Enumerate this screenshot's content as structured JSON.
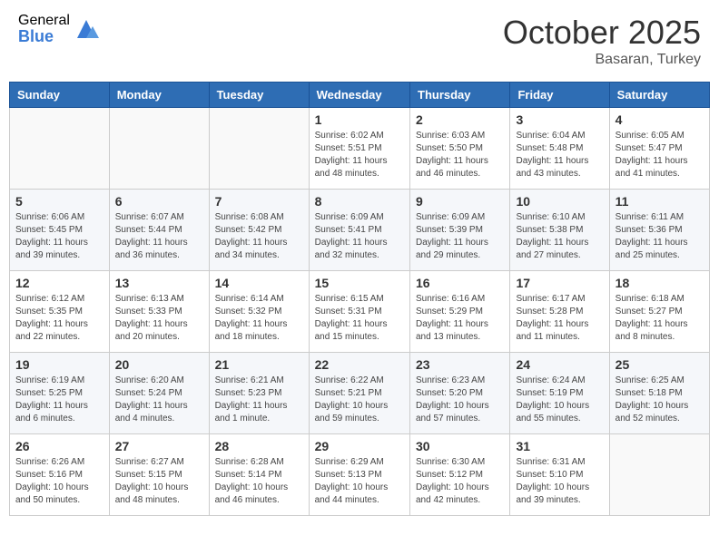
{
  "header": {
    "logo_general": "General",
    "logo_blue": "Blue",
    "month_title": "October 2025",
    "location": "Basaran, Turkey"
  },
  "weekdays": [
    "Sunday",
    "Monday",
    "Tuesday",
    "Wednesday",
    "Thursday",
    "Friday",
    "Saturday"
  ],
  "weeks": [
    [
      {
        "day": "",
        "info": ""
      },
      {
        "day": "",
        "info": ""
      },
      {
        "day": "",
        "info": ""
      },
      {
        "day": "1",
        "info": "Sunrise: 6:02 AM\nSunset: 5:51 PM\nDaylight: 11 hours\nand 48 minutes."
      },
      {
        "day": "2",
        "info": "Sunrise: 6:03 AM\nSunset: 5:50 PM\nDaylight: 11 hours\nand 46 minutes."
      },
      {
        "day": "3",
        "info": "Sunrise: 6:04 AM\nSunset: 5:48 PM\nDaylight: 11 hours\nand 43 minutes."
      },
      {
        "day": "4",
        "info": "Sunrise: 6:05 AM\nSunset: 5:47 PM\nDaylight: 11 hours\nand 41 minutes."
      }
    ],
    [
      {
        "day": "5",
        "info": "Sunrise: 6:06 AM\nSunset: 5:45 PM\nDaylight: 11 hours\nand 39 minutes."
      },
      {
        "day": "6",
        "info": "Sunrise: 6:07 AM\nSunset: 5:44 PM\nDaylight: 11 hours\nand 36 minutes."
      },
      {
        "day": "7",
        "info": "Sunrise: 6:08 AM\nSunset: 5:42 PM\nDaylight: 11 hours\nand 34 minutes."
      },
      {
        "day": "8",
        "info": "Sunrise: 6:09 AM\nSunset: 5:41 PM\nDaylight: 11 hours\nand 32 minutes."
      },
      {
        "day": "9",
        "info": "Sunrise: 6:09 AM\nSunset: 5:39 PM\nDaylight: 11 hours\nand 29 minutes."
      },
      {
        "day": "10",
        "info": "Sunrise: 6:10 AM\nSunset: 5:38 PM\nDaylight: 11 hours\nand 27 minutes."
      },
      {
        "day": "11",
        "info": "Sunrise: 6:11 AM\nSunset: 5:36 PM\nDaylight: 11 hours\nand 25 minutes."
      }
    ],
    [
      {
        "day": "12",
        "info": "Sunrise: 6:12 AM\nSunset: 5:35 PM\nDaylight: 11 hours\nand 22 minutes."
      },
      {
        "day": "13",
        "info": "Sunrise: 6:13 AM\nSunset: 5:33 PM\nDaylight: 11 hours\nand 20 minutes."
      },
      {
        "day": "14",
        "info": "Sunrise: 6:14 AM\nSunset: 5:32 PM\nDaylight: 11 hours\nand 18 minutes."
      },
      {
        "day": "15",
        "info": "Sunrise: 6:15 AM\nSunset: 5:31 PM\nDaylight: 11 hours\nand 15 minutes."
      },
      {
        "day": "16",
        "info": "Sunrise: 6:16 AM\nSunset: 5:29 PM\nDaylight: 11 hours\nand 13 minutes."
      },
      {
        "day": "17",
        "info": "Sunrise: 6:17 AM\nSunset: 5:28 PM\nDaylight: 11 hours\nand 11 minutes."
      },
      {
        "day": "18",
        "info": "Sunrise: 6:18 AM\nSunset: 5:27 PM\nDaylight: 11 hours\nand 8 minutes."
      }
    ],
    [
      {
        "day": "19",
        "info": "Sunrise: 6:19 AM\nSunset: 5:25 PM\nDaylight: 11 hours\nand 6 minutes."
      },
      {
        "day": "20",
        "info": "Sunrise: 6:20 AM\nSunset: 5:24 PM\nDaylight: 11 hours\nand 4 minutes."
      },
      {
        "day": "21",
        "info": "Sunrise: 6:21 AM\nSunset: 5:23 PM\nDaylight: 11 hours\nand 1 minute."
      },
      {
        "day": "22",
        "info": "Sunrise: 6:22 AM\nSunset: 5:21 PM\nDaylight: 10 hours\nand 59 minutes."
      },
      {
        "day": "23",
        "info": "Sunrise: 6:23 AM\nSunset: 5:20 PM\nDaylight: 10 hours\nand 57 minutes."
      },
      {
        "day": "24",
        "info": "Sunrise: 6:24 AM\nSunset: 5:19 PM\nDaylight: 10 hours\nand 55 minutes."
      },
      {
        "day": "25",
        "info": "Sunrise: 6:25 AM\nSunset: 5:18 PM\nDaylight: 10 hours\nand 52 minutes."
      }
    ],
    [
      {
        "day": "26",
        "info": "Sunrise: 6:26 AM\nSunset: 5:16 PM\nDaylight: 10 hours\nand 50 minutes."
      },
      {
        "day": "27",
        "info": "Sunrise: 6:27 AM\nSunset: 5:15 PM\nDaylight: 10 hours\nand 48 minutes."
      },
      {
        "day": "28",
        "info": "Sunrise: 6:28 AM\nSunset: 5:14 PM\nDaylight: 10 hours\nand 46 minutes."
      },
      {
        "day": "29",
        "info": "Sunrise: 6:29 AM\nSunset: 5:13 PM\nDaylight: 10 hours\nand 44 minutes."
      },
      {
        "day": "30",
        "info": "Sunrise: 6:30 AM\nSunset: 5:12 PM\nDaylight: 10 hours\nand 42 minutes."
      },
      {
        "day": "31",
        "info": "Sunrise: 6:31 AM\nSunset: 5:10 PM\nDaylight: 10 hours\nand 39 minutes."
      },
      {
        "day": "",
        "info": ""
      }
    ]
  ]
}
